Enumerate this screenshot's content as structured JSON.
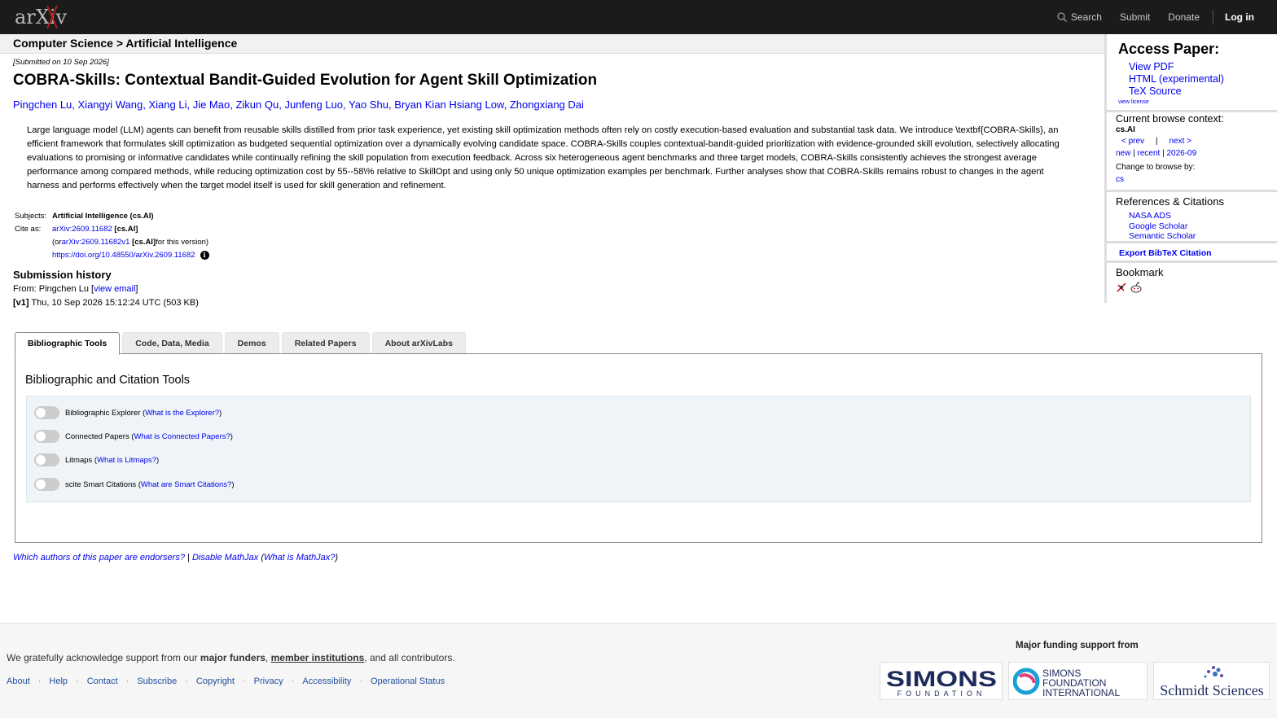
{
  "brand": {
    "logo_text": "arXiv"
  },
  "topnav": {
    "search": "Search",
    "submit": "Submit",
    "donate": "Donate",
    "login": "Log in"
  },
  "breadcrumb": "Computer Science > Artificial Intelligence",
  "paper": {
    "submitted": "[Submitted on 10 Sep 2026]",
    "title": "COBRA-Skills: Contextual Bandit-Guided Evolution for Agent Skill Optimization",
    "authors": [
      "Pingchen Lu",
      "Xiangyi Wang",
      "Xiang Li",
      "Jie Mao",
      "Zikun Qu",
      "Junfeng Luo",
      "Yao Shu",
      "Bryan Kian Hsiang Low",
      "Zhongxiang Dai"
    ],
    "abstract": "Large language model (LLM) agents can benefit from reusable skills distilled from prior task experience, yet existing skill optimization methods often rely on costly execution-based evaluation and substantial task data. We introduce \\textbf{COBRA-Skills}, an efficient framework that formulates skill optimization as budgeted sequential optimization over a dynamically evolving candidate space. COBRA-Skills couples contextual-bandit-guided prioritization with evidence-grounded skill evolution, selectively allocating evaluations to promising or informative candidates while continually refining the skill population from execution feedback. Across six heterogeneous agent benchmarks and three target models, COBRA-Skills consistently achieves the strongest average performance among compared methods, while reducing optimization cost by 55--58\\% relative to SkillOpt and using only 50 unique optimization examples per benchmark. Further analyses show that COBRA-Skills remains robust to changes in the agent harness and performs effectively when the target model itself is used for skill generation and refinement."
  },
  "meta": {
    "subjects_label": "Subjects:",
    "subjects_value": "Artificial Intelligence (cs.AI)",
    "cite_label": "Cite as:",
    "cite_id": "arXiv:2609.11682",
    "cite_cat": "[cs.AI]",
    "version_prefix": "(or ",
    "version_id": "arXiv:2609.11682v1",
    "version_cat": "[cs.AI]",
    "version_suffix": " for this version)",
    "doi": "https://doi.org/10.48550/arXiv.2609.11682"
  },
  "submission": {
    "heading": "Submission history",
    "from_prefix": "From: Pingchen Lu [",
    "view_email": "view email",
    "from_suffix": "]",
    "v1_label": "[v1]",
    "v1_text": " Thu, 10 Sep 2026 15:12:24 UTC (503 KB)"
  },
  "tabs": [
    "Bibliographic Tools",
    "Code, Data, Media",
    "Demos",
    "Related Papers",
    "About arXivLabs"
  ],
  "panel": {
    "title": "Bibliographic and Citation Tools",
    "tools": [
      {
        "label": "Bibliographic Explorer (",
        "link": "What is the Explorer?",
        "end": ")"
      },
      {
        "label": "Connected Papers (",
        "link": "What is Connected Papers?",
        "end": ")"
      },
      {
        "label": "Litmaps (",
        "link": "What is Litmaps?",
        "end": ")"
      },
      {
        "label": "scite Smart Citations (",
        "link": "What are Smart Citations?",
        "end": ")"
      }
    ]
  },
  "bottom_links": {
    "endorsers": "Which authors of this paper are endorsers?",
    "sep": " | ",
    "mathjax": "Disable MathJax",
    "what_mathjax": "What is MathJax?"
  },
  "sidebar": {
    "access_heading": "Access Paper:",
    "access_links": [
      "View PDF",
      "HTML (experimental)",
      "TeX Source"
    ],
    "license": "view license",
    "context_heading": "Current browse context:",
    "context_cat": "cs.AI",
    "prev": "< prev",
    "pipe": "|",
    "next": "next >",
    "new": "new",
    "recent": "recent",
    "month": "2026-09",
    "change_label": "Change to browse by:",
    "change_cat": "cs",
    "refs_heading": "References & Citations",
    "refs_links": [
      "NASA ADS",
      "Google Scholar",
      "Semantic Scholar"
    ],
    "export": "Export BibTeX Citation",
    "bookmark_heading": "Bookmark"
  },
  "footer": {
    "ack_prefix": "We gratefully acknowledge support from our ",
    "major_funders": "major funders",
    "comma": ", ",
    "member_institutions": "member institutions",
    "ack_suffix": ", and all contributors.",
    "links": [
      "About",
      "Help",
      "Contact",
      "Subscribe",
      "Copyright",
      "Privacy",
      "Accessibility",
      "Operational Status"
    ],
    "funding_heading": "Major funding support from",
    "funders": [
      {
        "line1": "SIMONS",
        "line2": "FOUNDATION"
      },
      {
        "line1": "SIMONS",
        "line2": "FOUNDATION",
        "line3": "INTERNATIONAL"
      },
      {
        "line1": "Schmidt Sciences"
      }
    ]
  },
  "colors": {
    "topbar": "#1b1b1b",
    "link": "#0000ee",
    "toolbox": "#eef4f7",
    "footer_link": "#1f4f9c"
  }
}
